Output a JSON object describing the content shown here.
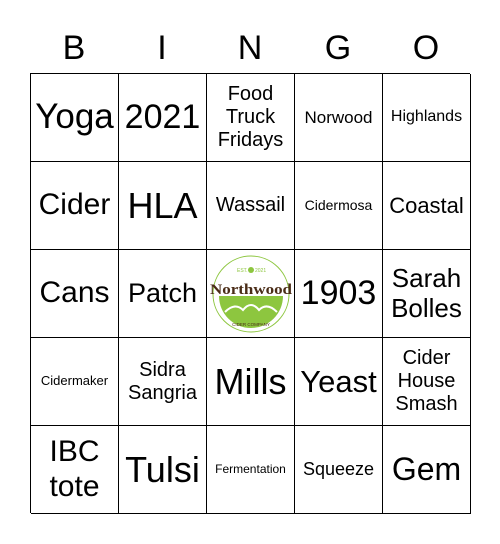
{
  "header": [
    "B",
    "I",
    "N",
    "G",
    "O"
  ],
  "cells": [
    "Yoga",
    "2021",
    "Food\nTruck\nFridays",
    "Norwood",
    "Highlands",
    "Cider",
    "HLA",
    "Wassail",
    "Cidermosa",
    "Coastal",
    "Cans",
    "Patch",
    "",
    "1903",
    "Sarah\nBolles",
    "Cidermaker",
    "Sidra\nSangria",
    "Mills",
    "Yeast",
    "Cider\nHouse\nSmash",
    "IBC\ntote",
    "Tulsi",
    "Fermentation",
    "Squeeze",
    "Gem"
  ],
  "free_space": {
    "logo_text": "Northwood",
    "est": "EST.",
    "year": "2021",
    "subtitle": "CIDER COMPANY"
  },
  "colors": {
    "logo_green": "#8dc63f",
    "logo_brown": "#4a2c17"
  }
}
